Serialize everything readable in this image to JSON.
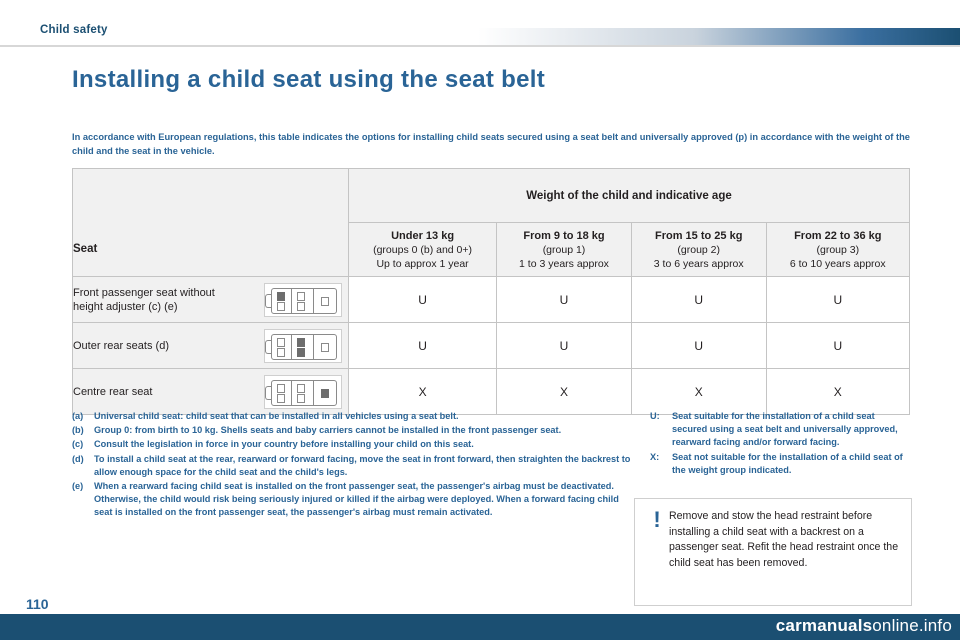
{
  "header": {
    "chapter": "Child safety",
    "title": "Installing a child seat using the seat belt"
  },
  "intro": "In accordance with European regulations, this table indicates the options for installing child seats secured using a seat belt and universally approved (p) in accordance with the weight of the child and the seat in the vehicle.",
  "table": {
    "top_header": "Weight of the child and indicative age",
    "seat_header": "Seat",
    "columns": [
      {
        "weight": "Under 13 kg",
        "group": "(groups 0 (b) and 0+)",
        "age": "Up to approx 1 year"
      },
      {
        "weight": "From 9 to 18 kg",
        "group": "(group 1)",
        "age": "1 to 3 years approx"
      },
      {
        "weight": "From 15 to 25 kg",
        "group": "(group 2)",
        "age": "3 to 6 years approx"
      },
      {
        "weight": "From 22 to 36 kg",
        "group": "(group 3)",
        "age": "6 to 10 years approx"
      }
    ],
    "rows": [
      {
        "label_line1": "Front passenger seat without",
        "label_line2": "height adjuster (c) (e)",
        "values": [
          "U",
          "U",
          "U",
          "U"
        ]
      },
      {
        "label_line1": "Outer rear seats (d)",
        "label_line2": "",
        "values": [
          "U",
          "U",
          "U",
          "U"
        ]
      },
      {
        "label_line1": "Centre rear seat",
        "label_line2": "",
        "values": [
          "X",
          "X",
          "X",
          "X"
        ]
      }
    ]
  },
  "footnotes_left": [
    {
      "key": "(a)",
      "text": "Universal child seat: child seat that can be installed in all vehicles using a seat belt."
    },
    {
      "key": "(b)",
      "text": "Group 0: from birth to 10 kg. Shells seats and baby carriers cannot be installed in the front passenger seat."
    },
    {
      "key": "(c)",
      "text": "Consult the legislation in force in your country before installing your child on this seat."
    },
    {
      "key": "(d)",
      "text": "To install a child seat at the rear, rearward or forward facing, move the seat in front forward, then straighten the backrest to allow enough space for the child seat and the child's legs."
    },
    {
      "key": "(e)",
      "text": "When a rearward facing child seat is installed on the front passenger seat, the passenger's airbag must be deactivated. Otherwise, the child would risk being seriously injured or killed if the airbag were deployed. When a forward facing child seat is installed on the front passenger seat, the passenger's airbag must remain activated."
    }
  ],
  "footnotes_right": [
    {
      "key": "U:",
      "text": "Seat suitable for the installation of a child seat secured using a seat belt and universally approved, rearward facing and/or forward facing."
    },
    {
      "key": "X:",
      "text": "Seat not suitable for the installation of a child seat of the weight group indicated."
    }
  ],
  "warning": {
    "icon": "!",
    "text": "Remove and stow the head restraint before installing a child seat with a backrest on a passenger seat. Refit the head restraint once the child seat has been removed."
  },
  "page_number": "110",
  "watermark": {
    "bold": "carmanuals",
    "normal": "online.info"
  }
}
